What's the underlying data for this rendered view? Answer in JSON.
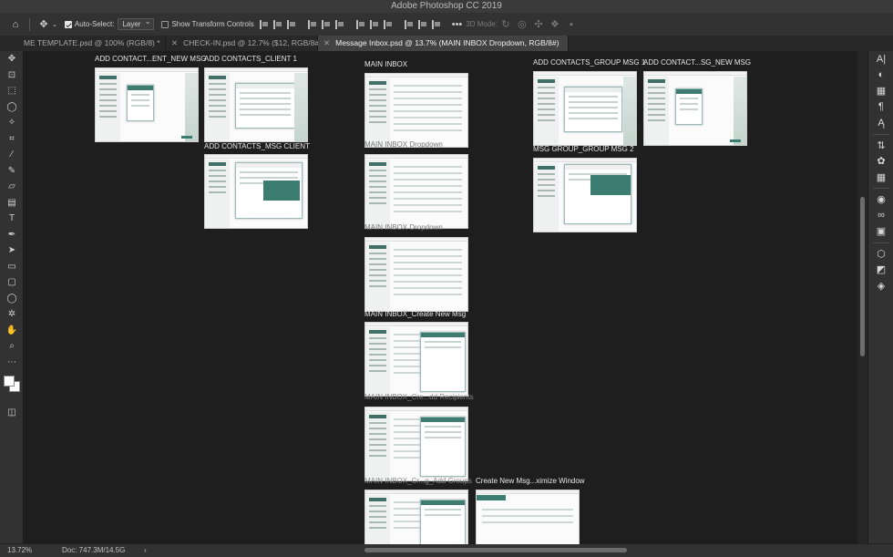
{
  "window": {
    "title": "Adobe Photoshop CC 2019"
  },
  "options_bar": {
    "home_icon": "home-icon",
    "move_icon": "move-icon",
    "auto_select_label": "Auto-Select:",
    "auto_select_checked": true,
    "auto_select_value": "Layer",
    "show_transform_label": "Show Transform Controls",
    "show_transform_checked": false,
    "more_label": "•••",
    "mode_3d_label": "3D Mode:"
  },
  "tabs": [
    {
      "label": "ME TEMPLATE.psd @ 100% (RGB/8) *",
      "active": false
    },
    {
      "label": "CHECK-IN.psd @ 12.7% ($12, RGB/8#)",
      "active": false
    },
    {
      "label": "Message Inbox.psd @ 13.7% (MAIN INBOX Dropdown, RGB/8#)",
      "active": true
    }
  ],
  "toolbar_icons": [
    "move-icon",
    "artboard-icon",
    "marquee-icon",
    "lasso-icon",
    "magic-wand-icon",
    "crop-icon",
    "eyedropper-icon",
    "brush-icon",
    "eraser-icon",
    "gradient-icon",
    "type-icon",
    "pen-icon",
    "path-select-icon",
    "rectangle-icon",
    "rounded-rect-icon",
    "ellipse-icon",
    "custom-shape-icon",
    "hand-icon",
    "zoom-icon",
    "more-tools-icon"
  ],
  "artboards": [
    {
      "label": "ADD CONTACT...ENT_NEW MSG"
    },
    {
      "label": "ADD CONTACTS_CLIENT 1"
    },
    {
      "label": "ADD CONTACTS_MSG CLIENT"
    },
    {
      "label": "MAIN INBOX"
    },
    {
      "label": "MAIN INBOX Dropdown"
    },
    {
      "label": "MAIN INBOX Dropdown"
    },
    {
      "label": "MAIN INBOX_Create New Msg"
    },
    {
      "label": "MAIN INBOX_Cre...dd Recipients"
    },
    {
      "label": "MAIN INBOX_Cr...g_Add Groups"
    },
    {
      "label": "Create New Msg...ximize Window"
    },
    {
      "label": "ADD CONTACTS_GROUP MSG 1"
    },
    {
      "label": "ADD CONTACT...SG_NEW MSG"
    },
    {
      "label": "MSG GROUP_GROUP MSG 2"
    }
  ],
  "status": {
    "zoom": "13.72%",
    "doc": "Doc: 747.3M/14.5G",
    "arrow": "›"
  },
  "colors": {
    "accent_teal": "#3c7d72",
    "chrome": "#323232",
    "canvas": "#1e1e1e"
  }
}
